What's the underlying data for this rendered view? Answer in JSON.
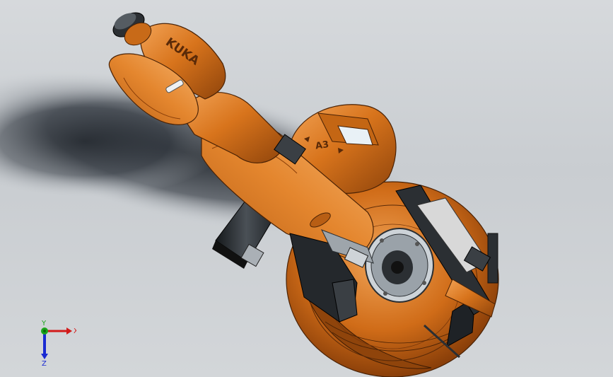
{
  "viewport": {
    "background": "#cfd2d6",
    "shadow_color": "#1c2127"
  },
  "model": {
    "description_icon": "kuka-robot-arm-3d-model",
    "body_color": "#d8741c",
    "body_dark": "#9a4a0c",
    "body_light": "#f0a256",
    "motor_color": "#2b2f33",
    "engravings": {
      "logo": "KUKA",
      "axis_label": "A3"
    }
  },
  "triad": {
    "x_label": "X",
    "y_label": "Y",
    "z_label": "Z",
    "x_color": "#d21a1a",
    "y_color": "#1aa51a",
    "z_color": "#1a2ad2"
  }
}
